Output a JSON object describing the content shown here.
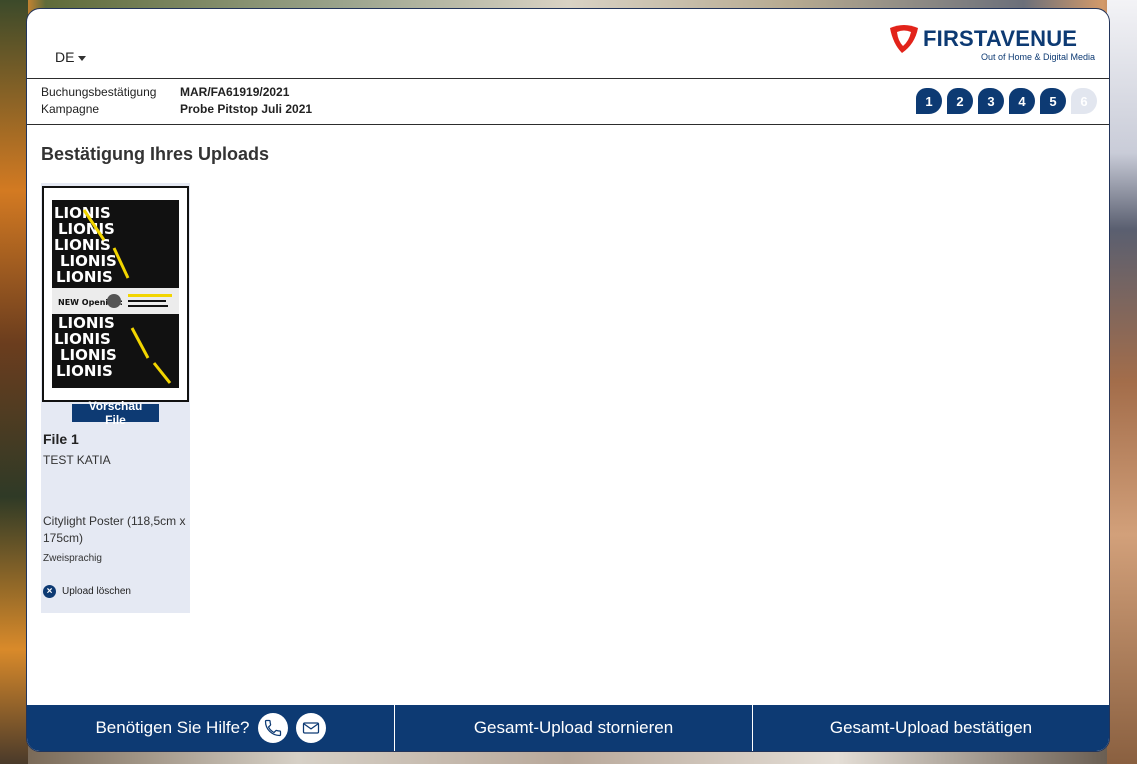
{
  "header": {
    "language": "DE",
    "logo_text": "FIRSTAVENUE",
    "logo_subtitle": "Out of Home & Digital Media"
  },
  "booking": {
    "confirmation_label": "Buchungsbestätigung",
    "confirmation_value": "MAR/FA61919/2021",
    "campaign_label": "Kampagne",
    "campaign_value": "Probe Pitstop Juli 2021"
  },
  "steps": [
    {
      "label": "1",
      "active": true
    },
    {
      "label": "2",
      "active": true
    },
    {
      "label": "3",
      "active": true
    },
    {
      "label": "4",
      "active": true
    },
    {
      "label": "5",
      "active": true
    },
    {
      "label": "6",
      "active": false
    }
  ],
  "main": {
    "title": "Bestätigung Ihres Uploads",
    "files": [
      {
        "preview_label": "Vorschau File",
        "name": "File 1",
        "description": "TEST KATIA",
        "format": "Citylight Poster (118,5cm x 175cm)",
        "language": "Zweisprachig",
        "delete_label": "Upload löschen",
        "poster_text": "LIONIS",
        "poster_badge": "NEW Opening:"
      }
    ]
  },
  "footer": {
    "help_label": "Benötigen Sie Hilfe?",
    "cancel_label": "Gesamt-Upload stornieren",
    "confirm_label": "Gesamt-Upload bestätigen"
  },
  "colors": {
    "brand_blue": "#0d3a73",
    "brand_red": "#e2231a",
    "card_bg": "#e5e9f3"
  },
  "icons": {
    "phone": "phone-icon",
    "mail": "mail-icon",
    "delete": "close-circle-icon"
  }
}
